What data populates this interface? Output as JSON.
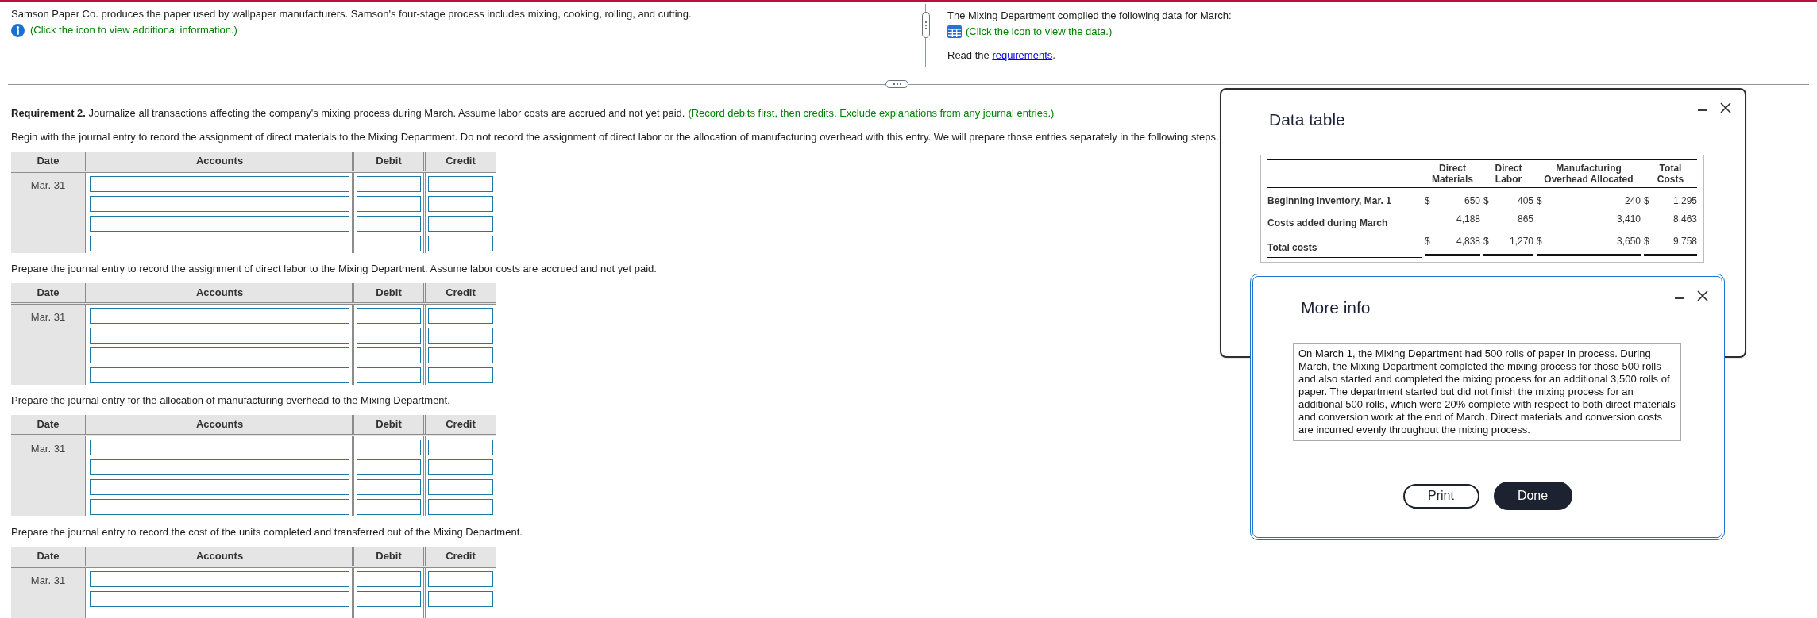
{
  "top_left": {
    "text": "Samson Paper Co. produces the paper used by wallpaper manufacturers. Samson's four-stage process includes mixing, cooking, rolling, and cutting.",
    "info_link": "(Click the icon to view additional information.)"
  },
  "top_right": {
    "text": "The Mixing Department compiled the following data for March:",
    "data_link": "(Click the icon to view the data.)",
    "read_before": "Read the",
    "read_link": "requirements",
    "read_after": "."
  },
  "requirement": {
    "text": "**Requirement 2.** Journalize all transactions affecting the company's mixing process during March. Assume labor costs are accrued and not yet paid.",
    "note": "(Record debits first, then credits. Exclude explanations from any journal entries.)"
  },
  "journal_entries": [
    {
      "prompt": "Begin with the journal entry to record the assignment of direct materials to the Mixing Department. Do not record the assignment of direct labor or the allocation of manufacturing overhead with this entry. We will prepare those entries separately in the following steps.",
      "columns": [
        "Date",
        "Accounts",
        "Debit",
        "Credit"
      ],
      "date": "Mar. 31",
      "lines": [
        {
          "disabled": false
        },
        {
          "disabled": false
        },
        {
          "disabled": false
        },
        {
          "disabled": false
        }
      ]
    },
    {
      "prompt": "Prepare the journal entry to record the assignment of direct labor to the Mixing Department. Assume labor costs are accrued and not yet paid.",
      "columns": [
        "Date",
        "Accounts",
        "Debit",
        "Credit"
      ],
      "date": "Mar. 31",
      "lines": [
        {
          "disabled": false
        },
        {
          "disabled": false
        },
        {
          "disabled": false
        },
        {
          "disabled": false
        }
      ]
    },
    {
      "prompt": "Prepare the journal entry for the allocation of manufacturing overhead to the Mixing Department.",
      "columns": [
        "Date",
        "Accounts",
        "Debit",
        "Credit"
      ],
      "date": "Mar. 31",
      "lines": [
        {
          "disabled": false
        },
        {
          "disabled": false
        },
        {
          "disabled": false
        },
        {
          "disabled": false
        }
      ]
    },
    {
      "prompt": "Prepare the journal entry to record the cost of the units completed and transferred out of the Mixing Department.",
      "columns": [
        "Date",
        "Accounts",
        "Debit",
        "Credit"
      ],
      "date": "Mar. 31",
      "lines": [
        {
          "disabled": false
        },
        {
          "disabled": false
        }
      ]
    }
  ],
  "data_table": {
    "title": "Data table",
    "columns": [
      "Direct Materials",
      "Direct Labor",
      "Manufacturing Overhead Allocated",
      "Total Costs"
    ],
    "rows": [
      {
        "kind": "plain",
        "label": "Beginning inventory, Mar. 1",
        "cells": [
          {
            "currency": "$",
            "value": "650"
          },
          {
            "currency": "$",
            "value": "405"
          },
          {
            "currency": "$",
            "value": "240"
          },
          {
            "currency": "$",
            "value": "1,295"
          }
        ]
      },
      {
        "kind": "underlined",
        "label": "Costs added during March",
        "cells": [
          {
            "value": "4,188"
          },
          {
            "value": "865"
          },
          {
            "value": "3,410"
          },
          {
            "value": "8,463"
          }
        ]
      },
      {
        "kind": "total",
        "label": "Total costs",
        "cells": [
          {
            "currency": "$",
            "value": "4,838"
          },
          {
            "currency": "$",
            "value": "1,270"
          },
          {
            "currency": "$",
            "value": "3,650"
          },
          {
            "currency": "$",
            "value": "9,758"
          }
        ]
      }
    ]
  },
  "more_info": {
    "title": "More info",
    "text": "On March 1, the Mixing Department had 500 rolls of paper in process. During March, the Mixing Department completed the mixing process for those 500 rolls and also started and completed the mixing process for an additional 3,500 rolls of paper. The department started but did not finish the mixing process for an additional 500 rolls, which were 20% complete with respect to both direct materials and conversion work at the end of March. Direct materials and conversion costs are incurred evenly throughout the mixing process.",
    "buttons": [
      {
        "label": "Print",
        "kind": "outline"
      },
      {
        "label": "Done",
        "kind": "filled"
      }
    ]
  }
}
